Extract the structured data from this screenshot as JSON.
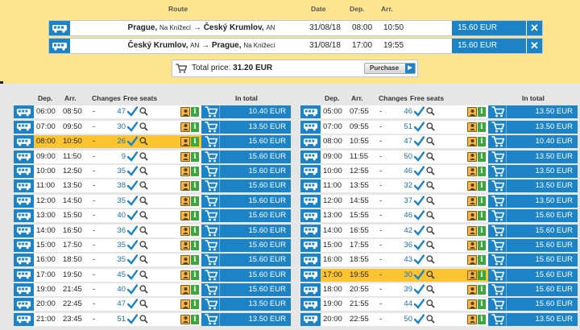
{
  "summary": {
    "headers": {
      "route": "Route",
      "date": "Date",
      "dep": "Dep.",
      "arr": "Arr."
    },
    "trips": [
      {
        "from": "Prague,",
        "from_stop": "Na Knížecí",
        "arrow": "→",
        "to": "Český Krumlov,",
        "to_stop": "AN",
        "date": "31/08/18",
        "dep": "08:00",
        "arr": "10:50",
        "price": "15.60 EUR",
        "remove": "✕"
      },
      {
        "from": "Český Krumlov,",
        "from_stop": "AN",
        "arrow": "→",
        "to": "Prague,",
        "to_stop": "Na Knížecí",
        "date": "31/08/18",
        "dep": "17:00",
        "arr": "19:55",
        "price": "15.60 EUR",
        "remove": "✕"
      }
    ],
    "total_label": "Total price:",
    "total_value": "31.20 EUR",
    "purchase_label": "Purchase",
    "purchase_arrow": "▶"
  },
  "table_headers": {
    "dep": "Dep.",
    "arr": "Arr.",
    "changes": "Changes",
    "seats": "Free seats",
    "total": "In total"
  },
  "outbound": [
    {
      "dep": "06:00",
      "arr": "08:50",
      "changes": "-",
      "seats": "47",
      "price": "10.40 EUR",
      "selected": false
    },
    {
      "dep": "07:00",
      "arr": "09:50",
      "changes": "-",
      "seats": "30",
      "price": "13.50 EUR",
      "selected": false
    },
    {
      "dep": "08:00",
      "arr": "10:50",
      "changes": "-",
      "seats": "26",
      "price": "15.60 EUR",
      "selected": true
    },
    {
      "dep": "09:00",
      "arr": "11:50",
      "changes": "-",
      "seats": "9",
      "price": "15.60 EUR",
      "selected": false
    },
    {
      "dep": "10:00",
      "arr": "12:50",
      "changes": "-",
      "seats": "35",
      "price": "15.60 EUR",
      "selected": false
    },
    {
      "dep": "11:00",
      "arr": "13:50",
      "changes": "-",
      "seats": "38",
      "price": "15.60 EUR",
      "selected": false
    },
    {
      "dep": "12:00",
      "arr": "14:50",
      "changes": "-",
      "seats": "35",
      "price": "15.60 EUR",
      "selected": false
    },
    {
      "dep": "13:00",
      "arr": "15:50",
      "changes": "-",
      "seats": "40",
      "price": "15.60 EUR",
      "selected": false
    },
    {
      "dep": "14:00",
      "arr": "16:50",
      "changes": "-",
      "seats": "36",
      "price": "15.60 EUR",
      "selected": false
    },
    {
      "dep": "15:00",
      "arr": "17:50",
      "changes": "-",
      "seats": "35",
      "price": "15.60 EUR",
      "selected": false
    },
    {
      "dep": "16:00",
      "arr": "18:50",
      "changes": "-",
      "seats": "35",
      "price": "15.60 EUR",
      "selected": false
    },
    {
      "dep": "17:00",
      "arr": "19:50",
      "changes": "-",
      "seats": "45",
      "price": "15.60 EUR",
      "selected": false
    },
    {
      "dep": "19:00",
      "arr": "21:45",
      "changes": "-",
      "seats": "40",
      "price": "15.60 EUR",
      "selected": false
    },
    {
      "dep": "20:00",
      "arr": "22:45",
      "changes": "-",
      "seats": "47",
      "price": "13.50 EUR",
      "selected": false
    },
    {
      "dep": "21:00",
      "arr": "23:45",
      "changes": "-",
      "seats": "51",
      "price": "13.50 EUR",
      "selected": false
    }
  ],
  "return": [
    {
      "dep": "05:00",
      "arr": "07:55",
      "changes": "-",
      "seats": "46",
      "price": "13.50 EUR",
      "selected": false
    },
    {
      "dep": "07:00",
      "arr": "09:55",
      "changes": "-",
      "seats": "51",
      "price": "13.50 EUR",
      "selected": false
    },
    {
      "dep": "08:00",
      "arr": "10:55",
      "changes": "-",
      "seats": "47",
      "price": "10.40 EUR",
      "selected": false
    },
    {
      "dep": "09:00",
      "arr": "11:55",
      "changes": "-",
      "seats": "50",
      "price": "13.50 EUR",
      "selected": false
    },
    {
      "dep": "10:00",
      "arr": "12:55",
      "changes": "-",
      "seats": "46",
      "price": "13.50 EUR",
      "selected": false
    },
    {
      "dep": "11:00",
      "arr": "13:55",
      "changes": "-",
      "seats": "32",
      "price": "13.50 EUR",
      "selected": false
    },
    {
      "dep": "12:00",
      "arr": "14:55",
      "changes": "-",
      "seats": "37",
      "price": "13.50 EUR",
      "selected": false
    },
    {
      "dep": "13:00",
      "arr": "15:55",
      "changes": "-",
      "seats": "46",
      "price": "15.60 EUR",
      "selected": false
    },
    {
      "dep": "14:00",
      "arr": "16:55",
      "changes": "-",
      "seats": "42",
      "price": "15.60 EUR",
      "selected": false
    },
    {
      "dep": "15:00",
      "arr": "17:55",
      "changes": "-",
      "seats": "36",
      "price": "15.60 EUR",
      "selected": false
    },
    {
      "dep": "16:00",
      "arr": "18:55",
      "changes": "-",
      "seats": "43",
      "price": "15.60 EUR",
      "selected": false
    },
    {
      "dep": "17:00",
      "arr": "19:55",
      "changes": "-",
      "seats": "30",
      "price": "15.60 EUR",
      "selected": true
    },
    {
      "dep": "18:00",
      "arr": "20:55",
      "changes": "-",
      "seats": "39",
      "price": "15.60 EUR",
      "selected": false
    },
    {
      "dep": "19:00",
      "arr": "21:55",
      "changes": "-",
      "seats": "44",
      "price": "15.60 EUR",
      "selected": false
    },
    {
      "dep": "20:00",
      "arr": "22:55",
      "changes": "-",
      "seats": "50",
      "price": "13.50 EUR",
      "selected": false
    }
  ],
  "colors": {
    "accent": "#1c83c6",
    "panel": "#fde58f",
    "selected": "#fdc431",
    "info": "#3aa73a"
  },
  "icons": {
    "bus": "bus-icon",
    "cart": "shopping-cart-icon",
    "check": "checkmark-icon",
    "search": "magnifier-icon",
    "driver": "driver-icon",
    "info": "info-icon",
    "remove": "close-icon"
  }
}
